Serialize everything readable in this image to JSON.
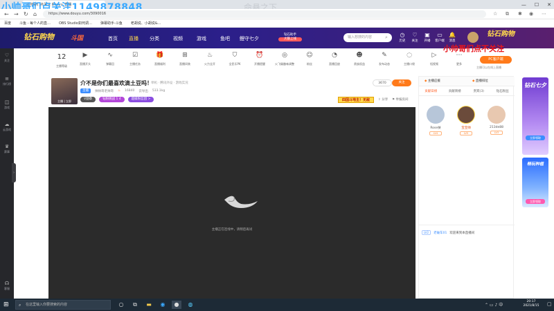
{
  "browser": {
    "tab_title": "小帅哥们点关注 Douyu_直播",
    "url": "https://www.douyu.com/3090016",
    "overlay_text": "小帅哥们点关注1149878848",
    "watermark": "命悬之下",
    "bookmarks": [
      "百度",
      "斗鱼 - 每个人的直…",
      "OBS Studio如何调…",
      "弹幕助手-斗鱼",
      "老胡说、小胡说&…"
    ]
  },
  "header": {
    "logo_left": "钻石购物",
    "logo_mid": "斗国",
    "nav": [
      "首页",
      "直播",
      "分类",
      "视频",
      "游戏",
      "鱼吧",
      "鲤守七夕"
    ],
    "promo_title": "钻石助手",
    "promo_button": "大额上线",
    "search_placeholder": "输入想搜的内容",
    "icons": [
      {
        "label": "历史",
        "icon": "clock-icon"
      },
      {
        "label": "关注",
        "icon": "heart-icon"
      },
      {
        "label": "开播",
        "icon": "camera-icon"
      },
      {
        "label": "客户端",
        "icon": "monitor-icon"
      },
      {
        "label": "消息",
        "icon": "bell-icon"
      }
    ],
    "logo_right": "钻石购物"
  },
  "sidebar": {
    "items": [
      {
        "label": "关注",
        "icon": "heart-icon"
      },
      {
        "label": "排行榜",
        "icon": "list-icon"
      },
      {
        "label": "游戏",
        "icon": "gamepad-icon"
      },
      {
        "label": "云游戏",
        "icon": "cloud-icon"
      },
      {
        "label": "赛事",
        "icon": "trophy-icon"
      },
      {
        "label": "客服",
        "icon": "headset-icon"
      }
    ]
  },
  "category_bar": {
    "level_number": "12",
    "level_label": "主播等级",
    "items": [
      {
        "label": "直播开头",
        "icon": "play-icon"
      },
      {
        "label": "弹幕回",
        "icon": "wave-icon"
      },
      {
        "label": "主播任务",
        "icon": "clipboard-icon"
      },
      {
        "label": "直播福利",
        "icon": "gift-icon"
      },
      {
        "label": "直播间装",
        "icon": "grid-icon"
      },
      {
        "label": "火力全开",
        "icon": "fire-icon"
      },
      {
        "label": "全民乐PK",
        "icon": "shield-icon"
      },
      {
        "label": "开播提醒",
        "icon": "alarm-icon"
      },
      {
        "label": "火飞碟趣味调整",
        "icon": "ufo-icon"
      },
      {
        "label": "粉丝",
        "icon": "people-icon"
      },
      {
        "label": "直播回放",
        "icon": "gauge-icon"
      },
      {
        "label": "贵族权益",
        "icon": "mask-icon"
      },
      {
        "label": "发布动态",
        "icon": "pen-icon"
      },
      {
        "label": "主播口袋",
        "icon": "bag-icon"
      },
      {
        "label": "短视频",
        "icon": "video-icon"
      },
      {
        "label": "更多",
        "icon": "more-icon"
      }
    ],
    "pc_app_button": "PC客户端",
    "pc_app_sub": "主播可以在线上直播"
  },
  "overlay_follow_text": "小帅哥们点不关注",
  "room": {
    "avatar_label": "主播 | 立即",
    "title": "介不是你们最喜欢滴土豆吗！",
    "category": "单机 · 腾讯外设 · 游戏实况",
    "tag": "主播",
    "streamer": "帅帅哥老帅哥",
    "hot": "16840",
    "days": "云导出",
    "weight": "533.1kg",
    "pills": [
      "V勋章",
      "钻粉挑战 1 4",
      "超级粉丝团 >"
    ],
    "follow_count": "3670",
    "follow_button": "关注",
    "banner": "四国斗地主！无敌",
    "share": "分享",
    "report": "举报房间"
  },
  "player": {
    "message": "主播正在连线中，请稍后再试"
  },
  "rightpanel": {
    "top_left": "主播应援",
    "top_right": "直播排位",
    "tabs": [
      "贡献日榜",
      "贡献周榜",
      "贵宾(3)",
      "钻石粉丝"
    ],
    "active_tab": 0,
    "ranks": [
      {
        "name": "Rose扶",
        "badge": "LV4",
        "color": "#b7c6d9"
      },
      {
        "name": "宝宝帅",
        "badge": "LV5",
        "color": "#6b4b3b"
      },
      {
        "name": "213de88",
        "badge": "LV3",
        "color": "#e8c8b0"
      }
    ],
    "msg_level": "LV2",
    "msg_user": "老破车01",
    "msg_text": "欢迎来到本直播间"
  },
  "ads": {
    "ad1_title": "钻石七夕",
    "ad1_button": "立即领取",
    "ad2_title": "畅玩种植",
    "ad2_button": "立即领取"
  },
  "taskbar": {
    "search_placeholder": "在这里输入你要搜索的内容",
    "time": "20:17",
    "date": "2021/8/15"
  }
}
